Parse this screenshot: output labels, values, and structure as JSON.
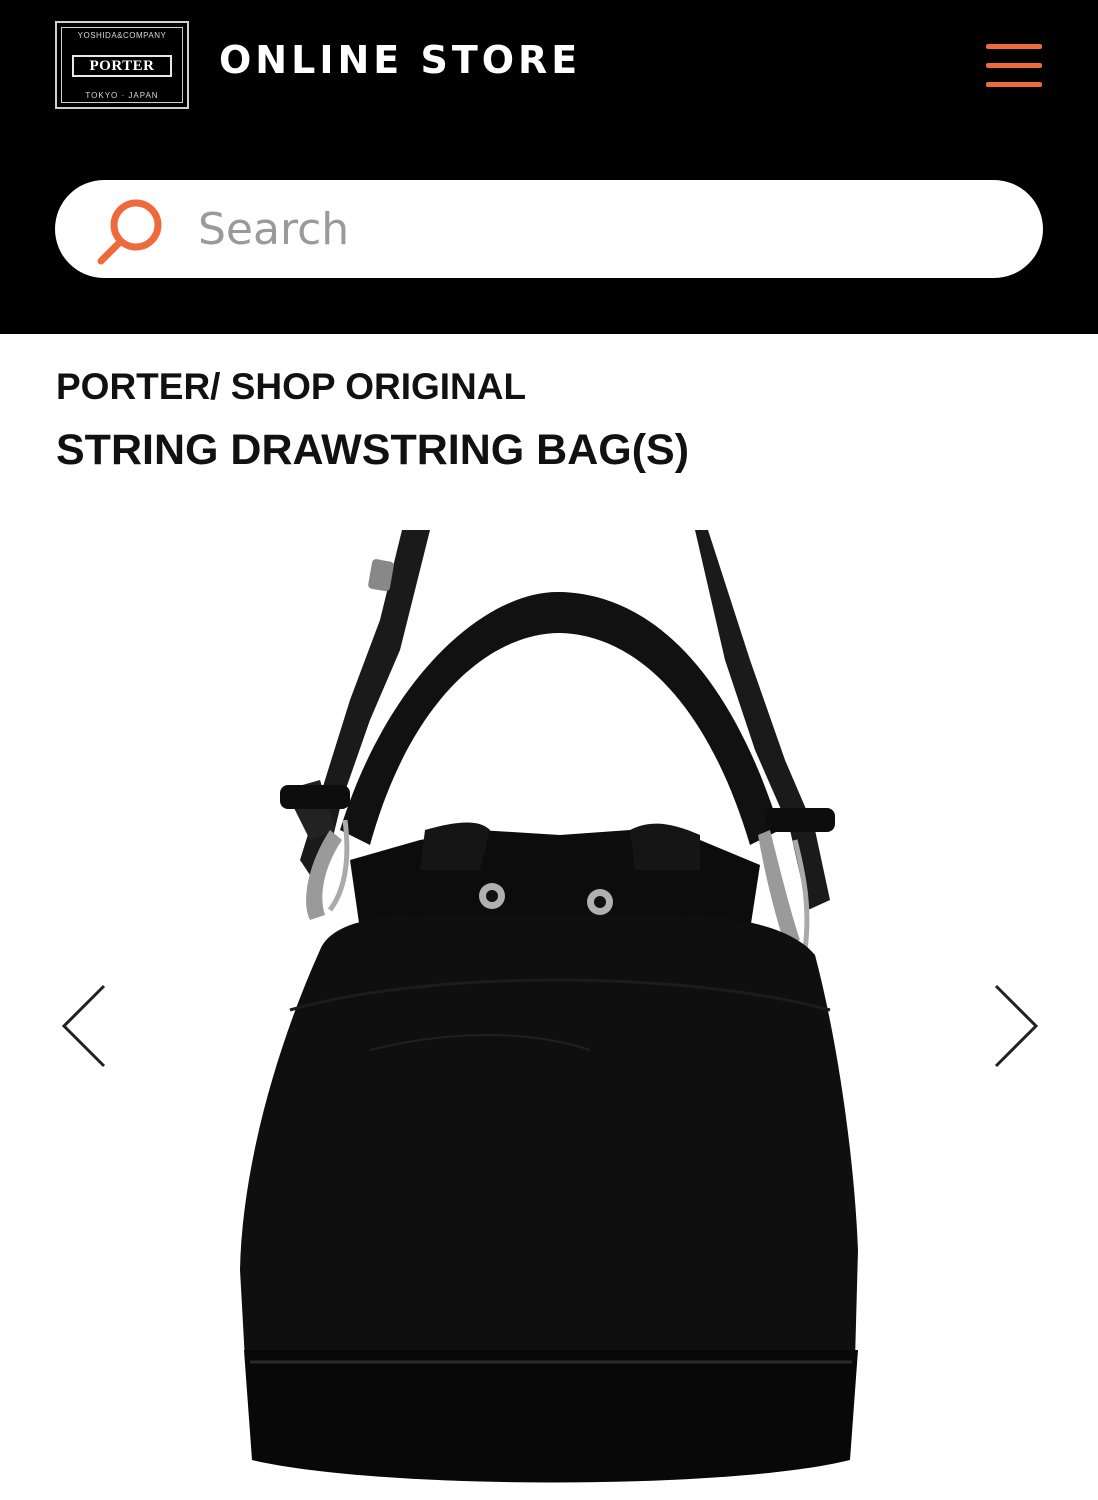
{
  "header": {
    "logo": {
      "top_text": "YOSHIDA&COMPANY",
      "brand": "PORTER",
      "bottom_text": "TOKYO · JAPAN"
    },
    "store_title": "ONLINE STORE",
    "menu_icon": "hamburger-menu-icon",
    "accent_color": "#ee6a3d",
    "background_color": "#000000"
  },
  "search": {
    "placeholder": "Search",
    "icon": "search-icon"
  },
  "product": {
    "brand_line": "PORTER/ SHOP ORIGINAL",
    "name": "STRING DRAWSTRING BAG(S)",
    "image": "product-photo-black-drawstring-bucket-bag"
  },
  "carousel": {
    "prev_icon": "chevron-left-icon",
    "next_icon": "chevron-right-icon"
  }
}
